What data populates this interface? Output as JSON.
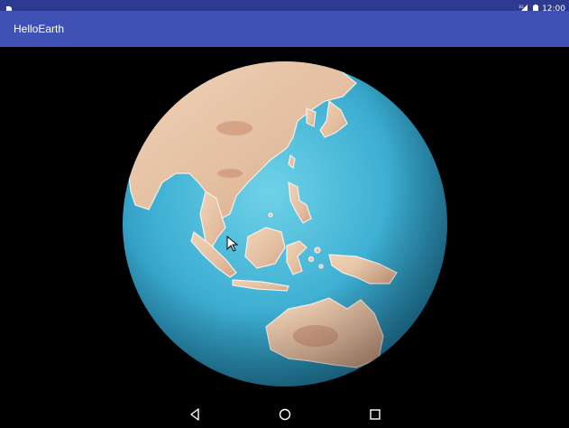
{
  "status_bar": {
    "time": "12:00",
    "network_label": "3G",
    "icons": [
      "sim-card-icon",
      "signal-icon",
      "battery-icon"
    ]
  },
  "app_bar": {
    "title": "HelloEarth",
    "color": "#3f51b5"
  },
  "navigation": {
    "buttons": [
      "back-icon",
      "home-icon",
      "recents-icon"
    ]
  },
  "globe": {
    "ocean_color": "#3fa9c9",
    "land_color": "#e8c9a8"
  }
}
